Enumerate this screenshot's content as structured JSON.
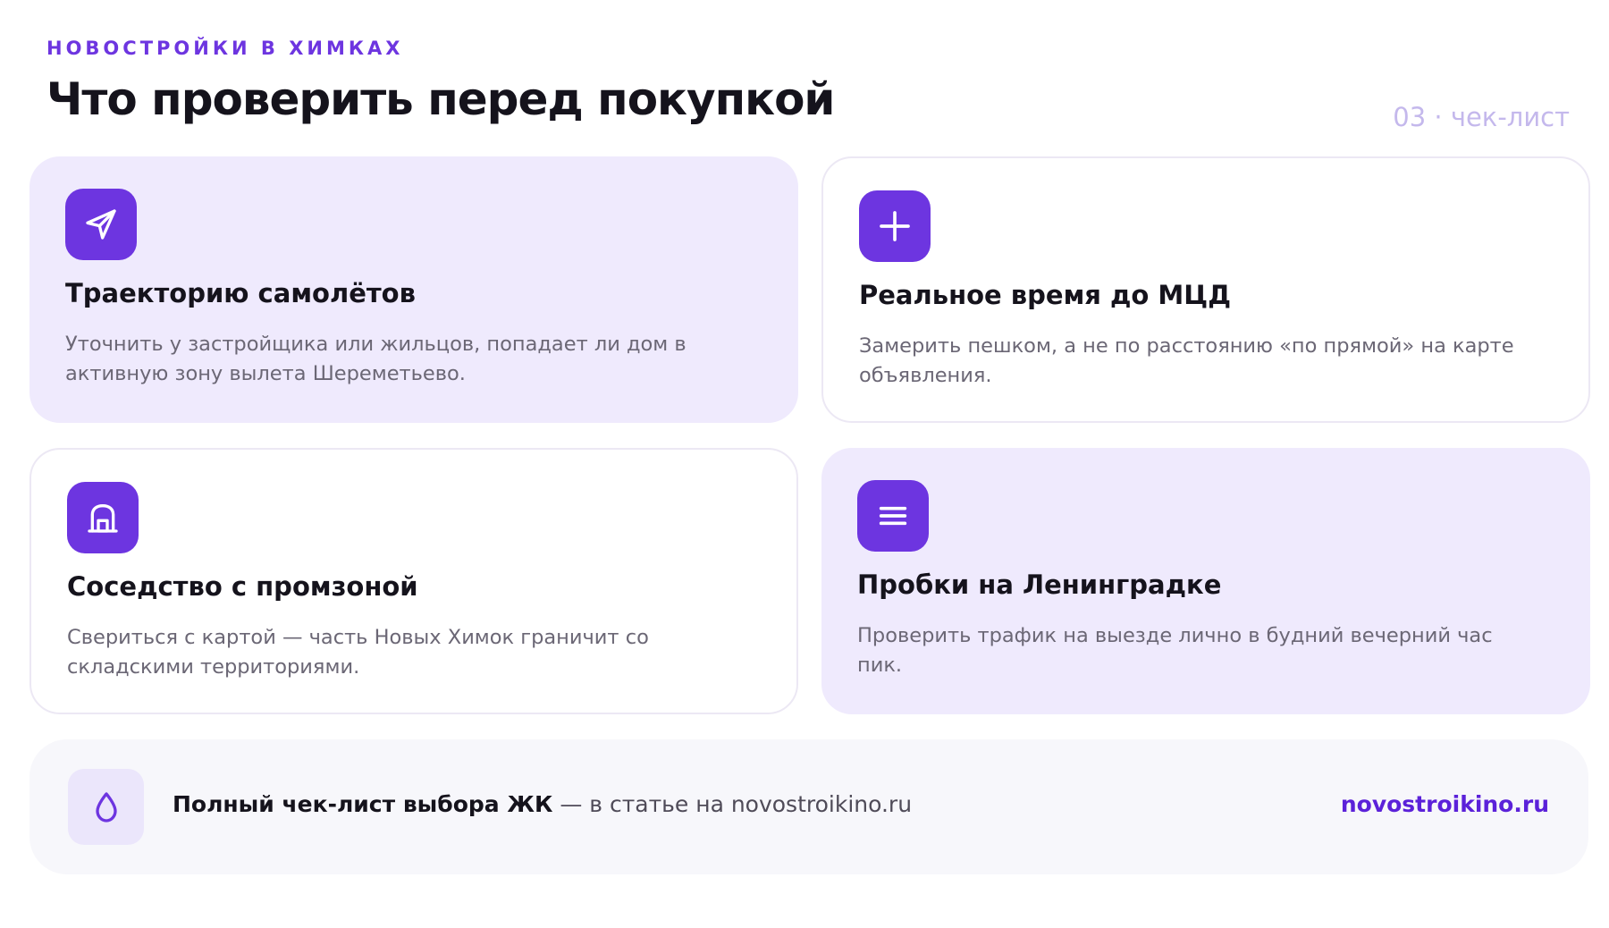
{
  "header": {
    "eyebrow": "НОВОСТРОЙКИ В ХИМКАХ",
    "title": "Что проверить перед покупкой",
    "page_label": "03 · чек-лист"
  },
  "cards": [
    {
      "icon": "paper-plane-icon",
      "title": "Траекторию самолётов",
      "description": "Уточнить у застройщика или жильцов, попадает ли дом в активную зону вылета Шереметьево."
    },
    {
      "icon": "plus-icon",
      "title": "Реальное время до МЦД",
      "description": "Замерить пешком, а не по расстоянию «по прямой» на карте объявления."
    },
    {
      "icon": "warehouse-icon",
      "title": "Соседство с промзоной",
      "description": "Свериться с картой — часть Новых Химок граничит со складскими территориями."
    },
    {
      "icon": "menu-lines-icon",
      "title": "Пробки на Ленинградке",
      "description": "Проверить трафик на выезде лично в будний вечерний час пик."
    }
  ],
  "footer": {
    "icon": "droplet-icon",
    "bold_text": "Полный чек-лист выбора ЖК",
    "rest_text": " — в статье на novostroikino.ru",
    "link": "novostroikino.ru"
  },
  "colors": {
    "accent": "#6d35e0",
    "card_fill": "#efeafd",
    "link": "#5b21d9",
    "page_label": "#c4b8ec"
  }
}
